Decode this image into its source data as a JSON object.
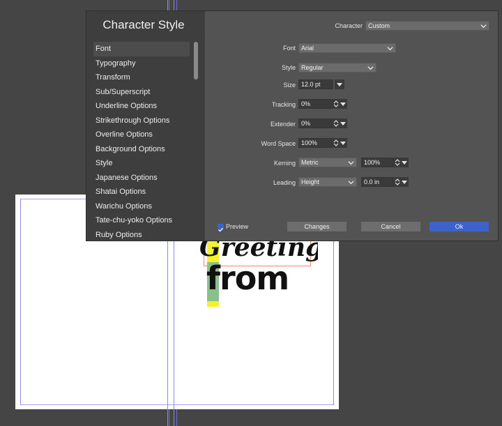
{
  "dialog": {
    "title": "Character Style",
    "character_label": "Character",
    "character_value": "Custom",
    "nav_items": [
      "Font",
      "Typography",
      "Transform",
      "Sub/Superscript",
      "Underline Options",
      "Strikethrough Options",
      "Overline Options",
      "Background Options",
      "Style",
      "Japanese Options",
      "Shatai Options",
      "Warichu Options",
      "Tate-chu-yoko Options",
      "Ruby Options"
    ],
    "font": {
      "label": "Font",
      "value": "Arial"
    },
    "style": {
      "label": "Style",
      "value": "Regular"
    },
    "size": {
      "label": "Size",
      "value": "12.0 pt"
    },
    "tracking": {
      "label": "Tracking",
      "value": "0%"
    },
    "extender": {
      "label": "Extender",
      "value": "0%"
    },
    "word_space": {
      "label": "Word Space",
      "value": "100%"
    },
    "kerning": {
      "label": "Kerning",
      "value": "Metric",
      "amount": "100%"
    },
    "leading": {
      "label": "Leading",
      "value": "Height",
      "amount": "0.0 in"
    },
    "preview": {
      "label": "Preview",
      "checked": true
    },
    "buttons": {
      "changes": "Changes",
      "cancel": "Cancel",
      "ok": "Ok"
    }
  },
  "canvas": {
    "text_line1": "Greetings",
    "text_line2": "from"
  },
  "colors": {
    "accent": "#3d63c9",
    "dialog_bg": "#535353",
    "panel_bg": "#3e3e3e",
    "workspace_bg": "#454545"
  }
}
